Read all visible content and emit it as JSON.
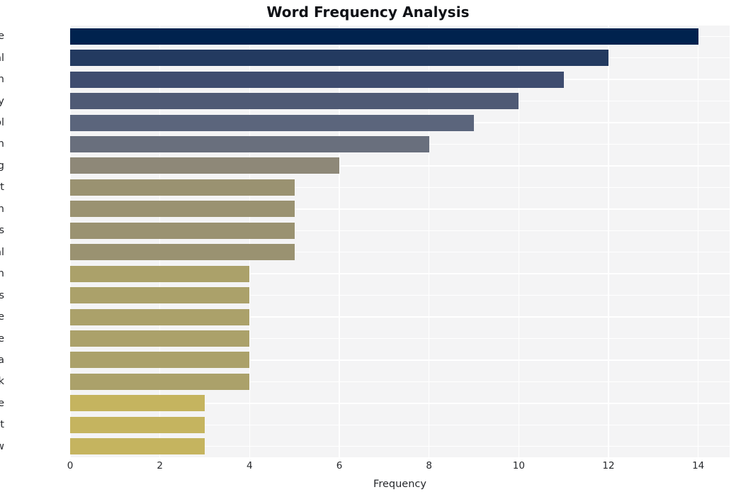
{
  "chart_data": {
    "type": "bar",
    "orientation": "horizontal",
    "title": "Word Frequency Analysis",
    "xlabel": "Frequency",
    "ylabel": "",
    "xlim": [
      0,
      14.7
    ],
    "ylim_categories": 20,
    "grid": true,
    "legend": null,
    "xticks": [
      "0",
      "2",
      "4",
      "6",
      "8",
      "10",
      "12",
      "14"
    ],
    "xtick_values": [
      0,
      2,
      4,
      6,
      8,
      10,
      12,
      14
    ],
    "categories": [
      "phone",
      "digital",
      "ban",
      "curiosity",
      "school",
      "learn",
      "young",
      "report",
      "education",
      "students",
      "critical",
      "distraction",
      "distractions",
      "people",
      "time",
      "media",
      "think",
      "article",
      "student",
      "new"
    ],
    "values": [
      14,
      12,
      11,
      10,
      9,
      8,
      6,
      5,
      5,
      5,
      5,
      4,
      4,
      4,
      4,
      4,
      4,
      3,
      3,
      3
    ],
    "bar_colors": [
      "#00224e",
      "#233a६0",
      "#3e4c६f",
      "#4f5a७५",
      "#5b657c",
      "#696f७d",
      "#8e8878",
      "#9a9271",
      "#9a9271",
      "#9a9271",
      "#9a9271",
      "#aba16a",
      "#aba16a",
      "#aba16a",
      "#aba16a",
      "#aba16a",
      "#aba16a",
      "#c5b45f",
      "#c5b45f",
      "#c5b45f"
    ],
    "colormap": "cividis",
    "plot_background": "#f4f4f5",
    "figure_background": "#ffffff",
    "gridline_color": "#ffffff"
  }
}
